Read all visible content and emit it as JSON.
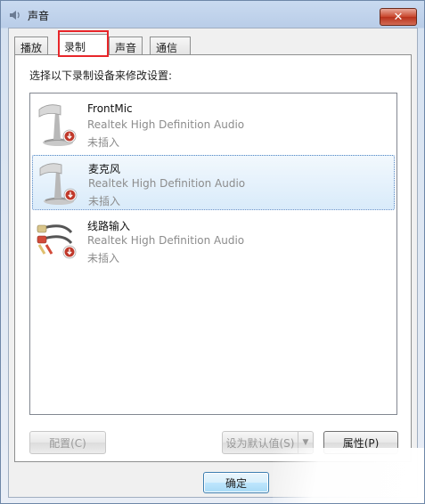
{
  "window": {
    "title": "声音",
    "close_symbol": "✕"
  },
  "tabs": [
    {
      "label": "播放"
    },
    {
      "label": "录制",
      "active": true
    },
    {
      "label": "声音"
    },
    {
      "label": "通信"
    }
  ],
  "panel": {
    "instruction": "选择以下录制设备来修改设置:"
  },
  "devices": [
    {
      "name": "FrontMic",
      "driver": "Realtek High Definition Audio",
      "status": "未插入",
      "icon": "microphone-icon",
      "selected": false
    },
    {
      "name": "麦克风",
      "driver": "Realtek High Definition Audio",
      "status": "未插入",
      "icon": "microphone-icon",
      "selected": true
    },
    {
      "name": "线路输入",
      "driver": "Realtek High Definition Audio",
      "status": "未插入",
      "icon": "rca-cable-icon",
      "selected": false
    }
  ],
  "buttons": {
    "configure": "配置(C)",
    "set_default": "设为默认值(S)",
    "properties": "属性(P)",
    "ok": "确定"
  },
  "colors": {
    "highlight_box": "#e8262a",
    "selected_border": "#5a8ac6",
    "unplugged_badge": "#c0392b"
  }
}
